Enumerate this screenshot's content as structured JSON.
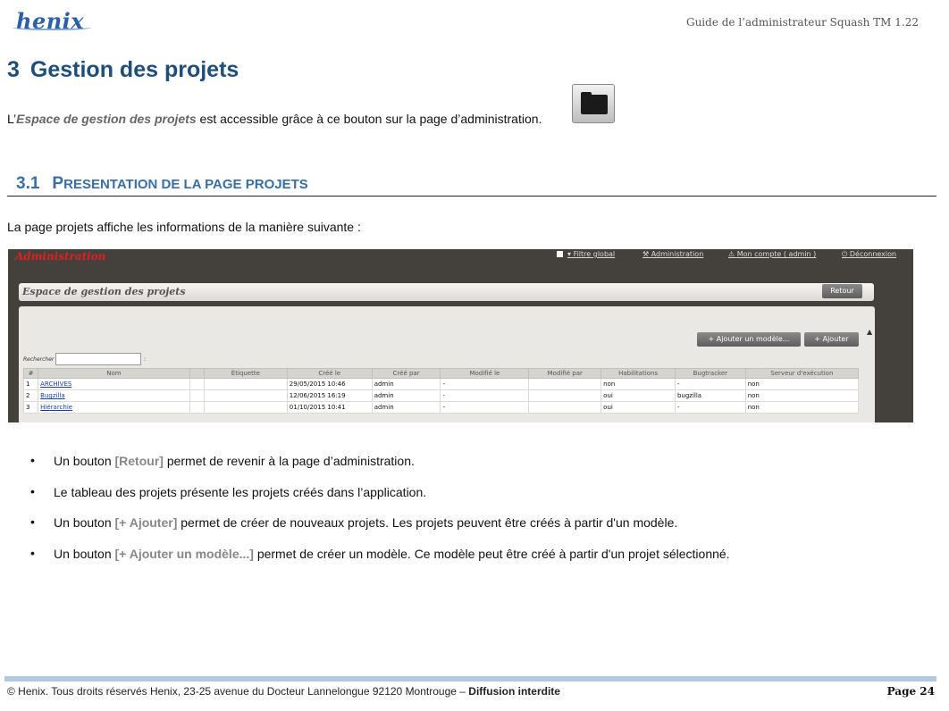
{
  "header": {
    "logo_text": "henix",
    "doc_title": "Guide de l’administrateur Squash TM 1.22"
  },
  "chapter": {
    "number": "3",
    "title": "Gestion des projets"
  },
  "intro": {
    "prefix": "L’",
    "emphasis": "Espace de gestion des projets",
    "suffix": " est accessible grâce à ce bouton sur la page d’administration.",
    "button_icon": "folder-icon"
  },
  "section": {
    "number": "3.1",
    "title_initial_1": "P",
    "title_rest_1": "RESENTATION DE LA PAGE PROJETS"
  },
  "lead_text": "La page projets affiche les informations de la manière suivante :",
  "screenshot": {
    "app_title": "Administration",
    "nav": {
      "filter": "Filtre global",
      "admin": "Administration",
      "account": "Mon compte ( admin )",
      "logout": "Déconnexion"
    },
    "panel_title": "Espace de gestion des projets",
    "retour": "Retour",
    "add_template": "+ Ajouter un modèle...",
    "add": "+ Ajouter",
    "search_label": "Rechercher",
    "columns": [
      "#",
      "Nom",
      "",
      "Étiquette",
      "Créé le",
      "Créé par",
      "Modifié le",
      "Modifié par",
      "Habilitations",
      "Bugtracker",
      "Serveur d'exécution"
    ],
    "rows": [
      [
        "1",
        "ARCHIVES",
        "",
        "",
        "29/05/2015 10:46",
        "admin",
        "-",
        "",
        "non",
        "-",
        "non"
      ],
      [
        "2",
        "Bugzilla",
        "",
        "",
        "12/06/2015 16:19",
        "admin",
        "-",
        "",
        "oui",
        "bugzilla",
        "non"
      ],
      [
        "3",
        "Hiérarchie",
        "",
        "",
        "01/10/2015 10:41",
        "admin",
        "-",
        "",
        "oui",
        "-",
        "non"
      ]
    ]
  },
  "bullets": [
    {
      "pre": "Un bouton ",
      "ref": "[Retour]",
      "post": " permet de revenir à la page d’administration."
    },
    {
      "pre": "Le tableau des projets présente les projets créés dans l’application.",
      "ref": "",
      "post": ""
    },
    {
      "pre": "Un bouton ",
      "ref": "[+ Ajouter]",
      "post": " permet de créer de nouveaux projets. Les projets peuvent être créés à partir d'un modèle."
    },
    {
      "pre": "Un bouton ",
      "ref": "[+ Ajouter un modèle...]",
      "post": " permet de créer un modèle. Ce modèle peut être créé à partir d'un projet sélectionné."
    }
  ],
  "footer": {
    "text": "© Henix. Tous droits réservés Henix, 23-25 avenue du Docteur Lannelongue 92120 Montrouge – ",
    "bold": "Diffusion interdite",
    "page": "Page 24"
  }
}
